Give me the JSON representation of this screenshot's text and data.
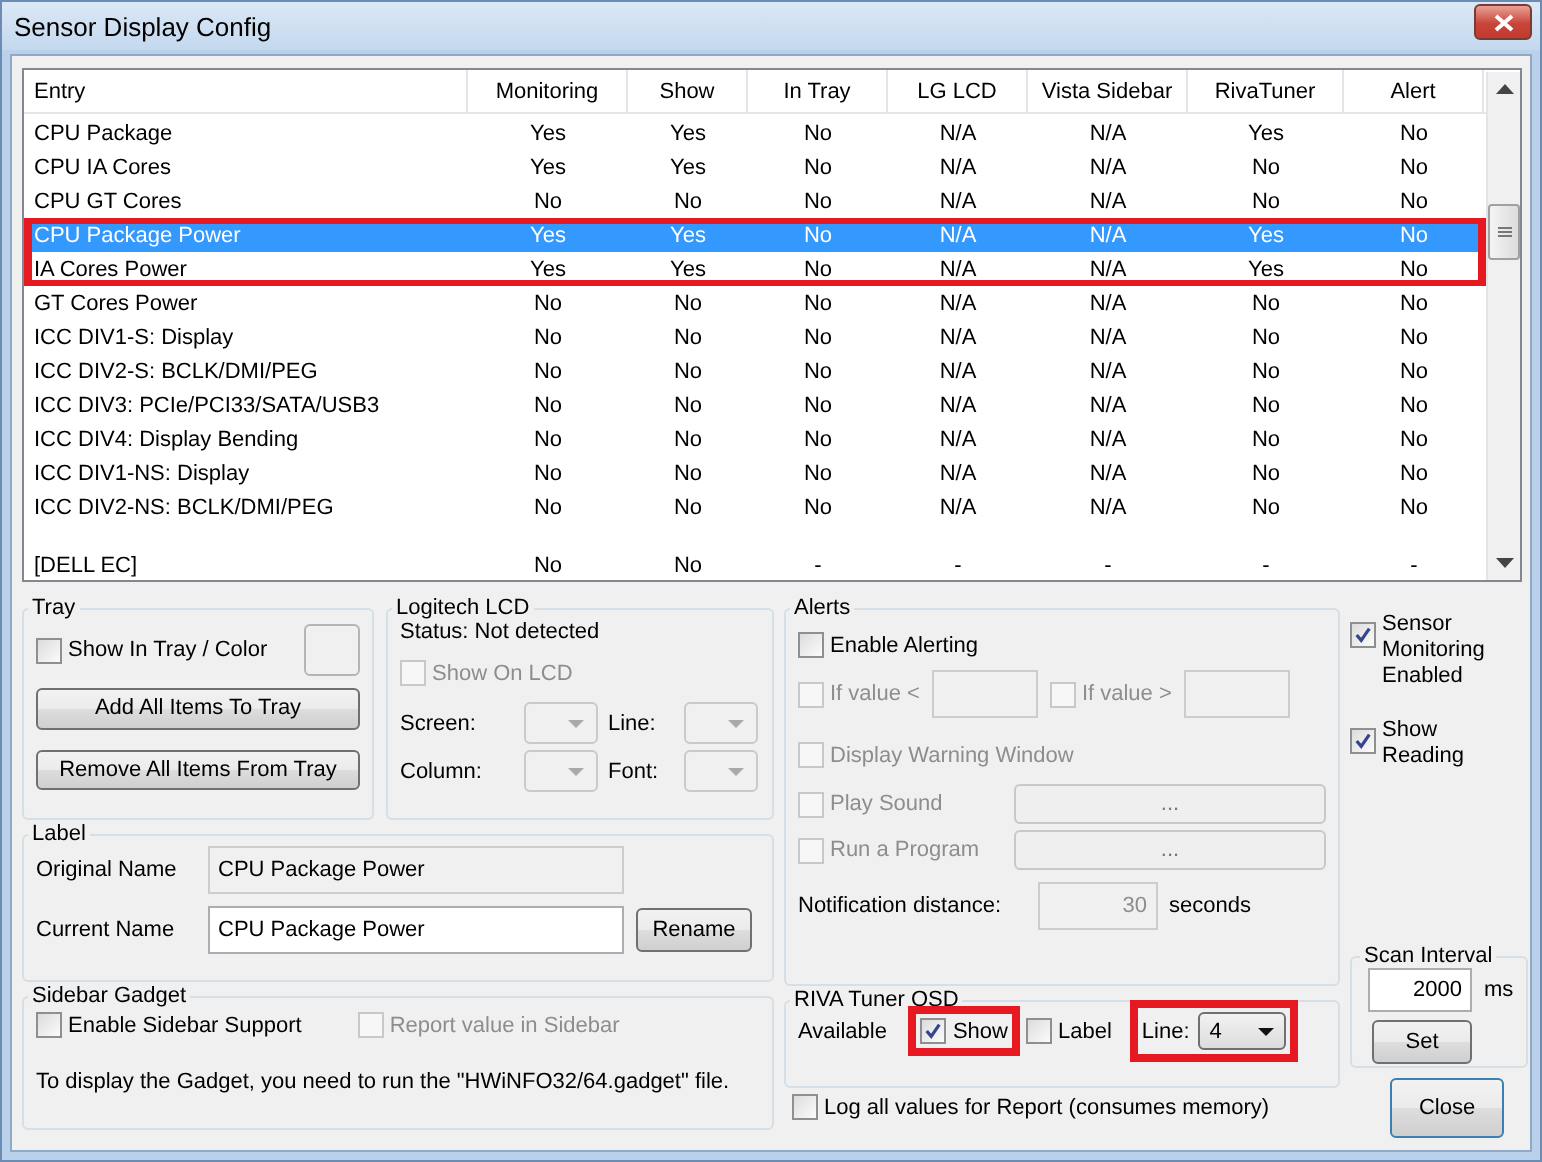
{
  "window": {
    "title": "Sensor Display Config"
  },
  "table": {
    "columns": [
      "Entry",
      "Monitoring",
      "Show",
      "In Tray",
      "LG LCD",
      "Vista Sidebar",
      "RivaTuner",
      "Alert"
    ],
    "rows": [
      {
        "kind": "sensor",
        "selected": false,
        "highlighted": false,
        "cells": [
          "CPU Package",
          "Yes",
          "Yes",
          "No",
          "N/A",
          "N/A",
          "Yes",
          "No"
        ]
      },
      {
        "kind": "sensor",
        "selected": false,
        "highlighted": false,
        "cells": [
          "CPU IA Cores",
          "Yes",
          "Yes",
          "No",
          "N/A",
          "N/A",
          "No",
          "No"
        ]
      },
      {
        "kind": "sensor",
        "selected": false,
        "highlighted": false,
        "cells": [
          "CPU GT Cores",
          "No",
          "No",
          "No",
          "N/A",
          "N/A",
          "No",
          "No"
        ]
      },
      {
        "kind": "sensor",
        "selected": true,
        "highlighted": true,
        "cells": [
          "CPU Package Power",
          "Yes",
          "Yes",
          "No",
          "N/A",
          "N/A",
          "Yes",
          "No"
        ]
      },
      {
        "kind": "sensor",
        "selected": false,
        "highlighted": true,
        "cells": [
          "IA Cores Power",
          "Yes",
          "Yes",
          "No",
          "N/A",
          "N/A",
          "Yes",
          "No"
        ]
      },
      {
        "kind": "sensor",
        "selected": false,
        "highlighted": false,
        "cells": [
          "GT Cores Power",
          "No",
          "No",
          "No",
          "N/A",
          "N/A",
          "No",
          "No"
        ]
      },
      {
        "kind": "sensor",
        "selected": false,
        "highlighted": false,
        "cells": [
          "ICC DIV1-S: Display",
          "No",
          "No",
          "No",
          "N/A",
          "N/A",
          "No",
          "No"
        ]
      },
      {
        "kind": "sensor",
        "selected": false,
        "highlighted": false,
        "cells": [
          "ICC DIV2-S: BCLK/DMI/PEG",
          "No",
          "No",
          "No",
          "N/A",
          "N/A",
          "No",
          "No"
        ]
      },
      {
        "kind": "sensor",
        "selected": false,
        "highlighted": false,
        "cells": [
          "ICC DIV3: PCIe/PCI33/SATA/USB3",
          "No",
          "No",
          "No",
          "N/A",
          "N/A",
          "No",
          "No"
        ]
      },
      {
        "kind": "sensor",
        "selected": false,
        "highlighted": false,
        "cells": [
          "ICC DIV4: Display Bending",
          "No",
          "No",
          "No",
          "N/A",
          "N/A",
          "No",
          "No"
        ]
      },
      {
        "kind": "sensor",
        "selected": false,
        "highlighted": false,
        "cells": [
          "ICC DIV1-NS: Display",
          "No",
          "No",
          "No",
          "N/A",
          "N/A",
          "No",
          "No"
        ]
      },
      {
        "kind": "sensor",
        "selected": false,
        "highlighted": false,
        "cells": [
          "ICC DIV2-NS: BCLK/DMI/PEG",
          "No",
          "No",
          "No",
          "N/A",
          "N/A",
          "No",
          "No"
        ]
      },
      {
        "kind": "group",
        "selected": false,
        "highlighted": false,
        "cells": [
          "[DELL EC]",
          "No",
          "No",
          "-",
          "-",
          "-",
          "-",
          "-"
        ]
      }
    ]
  },
  "tray": {
    "title": "Tray",
    "show_in_tray": {
      "label": "Show In Tray / Color",
      "checked": false,
      "disabled": false
    },
    "buttons": [
      "Add All Items To Tray",
      "Remove All Items From Tray"
    ]
  },
  "logitech_lcd": {
    "title": "Logitech LCD",
    "status": "Status: Not detected",
    "show_on_lcd": {
      "label": "Show On LCD",
      "checked": false,
      "disabled": true
    },
    "fields": [
      {
        "label": "Screen:",
        "disabled": true
      },
      {
        "label": "Line:",
        "disabled": true
      },
      {
        "label": "Column:",
        "disabled": true
      },
      {
        "label": "Font:",
        "disabled": true
      }
    ]
  },
  "label": {
    "title": "Label",
    "original_name": {
      "label": "Original Name",
      "value": "CPU Package Power",
      "disabled": true
    },
    "current_name": {
      "label": "Current Name",
      "value": "CPU Package Power",
      "disabled": false
    },
    "rename_button": "Rename"
  },
  "sidebar_gadget": {
    "title": "Sidebar Gadget",
    "enable": {
      "label": "Enable Sidebar Support",
      "checked": false,
      "disabled": false
    },
    "report": {
      "label": "Report value in Sidebar",
      "checked": false,
      "disabled": true
    },
    "note": "To display the Gadget, you need to run the \"HWiNFO32/64.gadget\" file."
  },
  "alerts": {
    "title": "Alerts",
    "enable": {
      "label": "Enable Alerting",
      "checked": false,
      "disabled": false
    },
    "if_below": {
      "label": "If value <",
      "checked": false,
      "disabled": true
    },
    "if_above": {
      "label": "If value >",
      "checked": false,
      "disabled": true
    },
    "display_warning": {
      "label": "Display Warning Window",
      "checked": false,
      "disabled": true
    },
    "play_sound": {
      "label": "Play Sound",
      "checked": false,
      "disabled": true,
      "button": "..."
    },
    "run_program": {
      "label": "Run a Program",
      "checked": false,
      "disabled": true,
      "button": "..."
    },
    "notification_distance": {
      "label": "Notification distance:",
      "value": "30",
      "unit": "seconds"
    }
  },
  "riva_osd": {
    "title": "RIVA Tuner OSD",
    "available": "Available",
    "show": {
      "label": "Show",
      "checked": true,
      "disabled": false,
      "highlighted": true
    },
    "label": {
      "label": "Label",
      "checked": false,
      "disabled": false
    },
    "line": {
      "label": "Line:",
      "value": "4",
      "highlighted": true
    }
  },
  "log_all": {
    "label": "Log all values for Report (consumes memory)",
    "checked": false,
    "disabled": false
  },
  "sensor_monitoring": {
    "label": "Sensor Monitoring Enabled",
    "checked": true,
    "disabled": false
  },
  "show_reading": {
    "label": "Show Reading",
    "checked": true,
    "disabled": false
  },
  "scan_interval": {
    "title": "Scan Interval",
    "value": "2000",
    "unit": "ms",
    "set_button": "Set"
  },
  "close_button": "Close"
}
